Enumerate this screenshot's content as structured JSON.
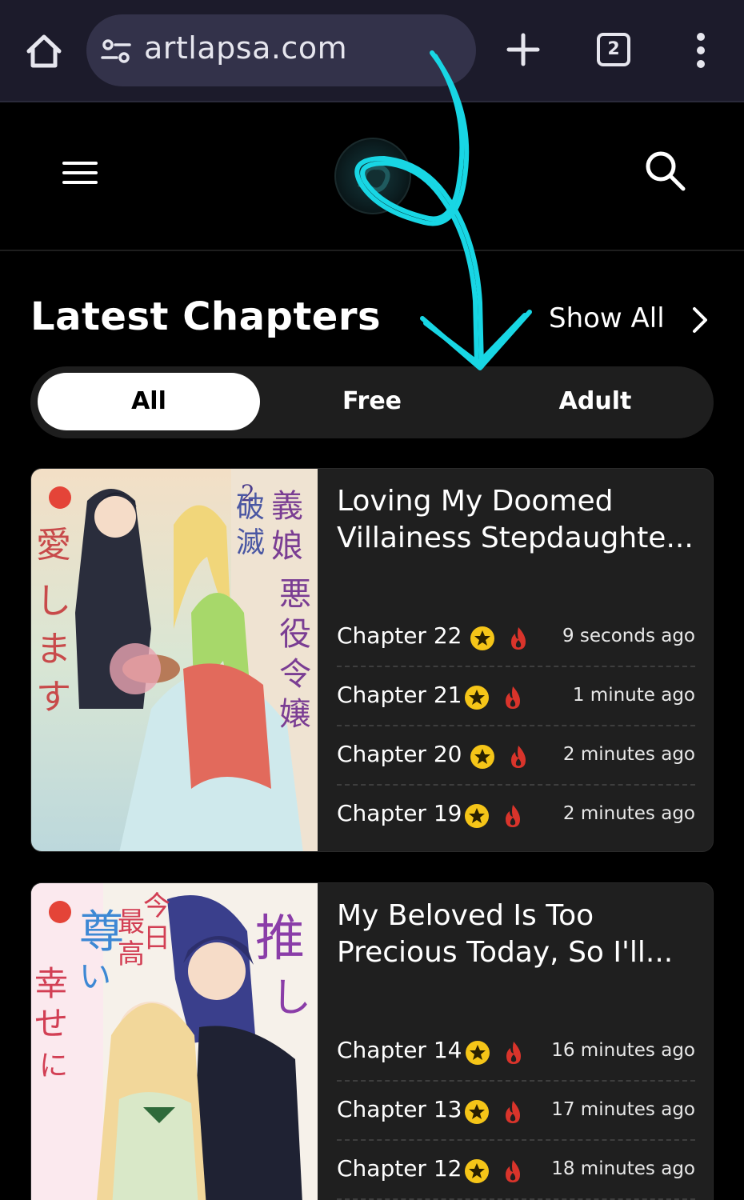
{
  "browser": {
    "url": "artlapsa.com",
    "tab_count": "2"
  },
  "section": {
    "title": "Latest Chapters",
    "show_all_label": "Show All"
  },
  "filters": {
    "tabs": [
      {
        "label": "All",
        "active": true
      },
      {
        "label": "Free",
        "active": false
      },
      {
        "label": "Adult",
        "active": false
      }
    ]
  },
  "cards": [
    {
      "title": "Loving My Doomed Villainess Stepdaughte...",
      "chapters": [
        {
          "label": "Chapter 22",
          "time": "9 seconds ago"
        },
        {
          "label": "Chapter 21",
          "time": "1 minute ago"
        },
        {
          "label": "Chapter 20",
          "time": "2 minutes ago"
        },
        {
          "label": "Chapter 19",
          "time": "2 minutes ago"
        }
      ]
    },
    {
      "title": "My Beloved Is Too Precious Today, So I'll...",
      "chapters": [
        {
          "label": "Chapter 14",
          "time": "16 minutes ago"
        },
        {
          "label": "Chapter 13",
          "time": "17 minutes ago"
        },
        {
          "label": "Chapter 12",
          "time": "18 minutes ago"
        }
      ]
    }
  ],
  "colors": {
    "accent_annotation": "#18d6e4",
    "star_badge": "#f5c518",
    "fire_badge": "#d9342b",
    "card_bg": "#1f1f1f"
  },
  "icons": [
    "home-icon",
    "tune-icon",
    "plus-icon",
    "tabs-icon",
    "more-vert-icon",
    "hamburger-icon",
    "site-logo",
    "search-icon",
    "chevron-right-icon",
    "star-badge-icon",
    "fire-badge-icon"
  ]
}
